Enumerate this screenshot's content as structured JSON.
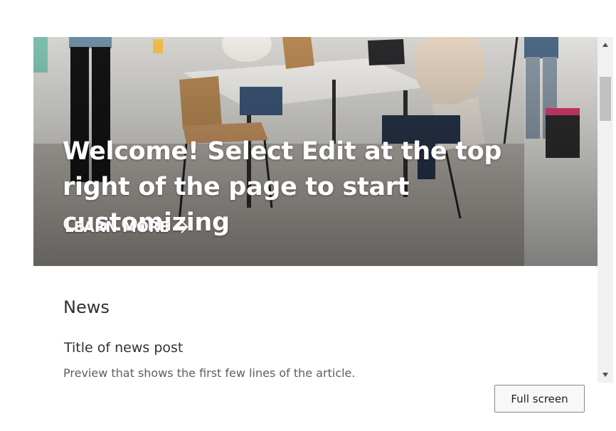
{
  "hero": {
    "title": "Welcome! Select Edit at the top right of the page to start customizing",
    "learn_more_label": "LEARN MORE",
    "image_icon": "office-meeting-photo"
  },
  "news": {
    "heading": "News",
    "post_title": "Title of news post",
    "post_preview": "Preview that shows the first few lines of the article."
  },
  "scrollbar": {
    "up_icon": "triangle-up-icon",
    "down_icon": "triangle-down-icon"
  },
  "actions": {
    "fullscreen_label": "Full screen"
  }
}
